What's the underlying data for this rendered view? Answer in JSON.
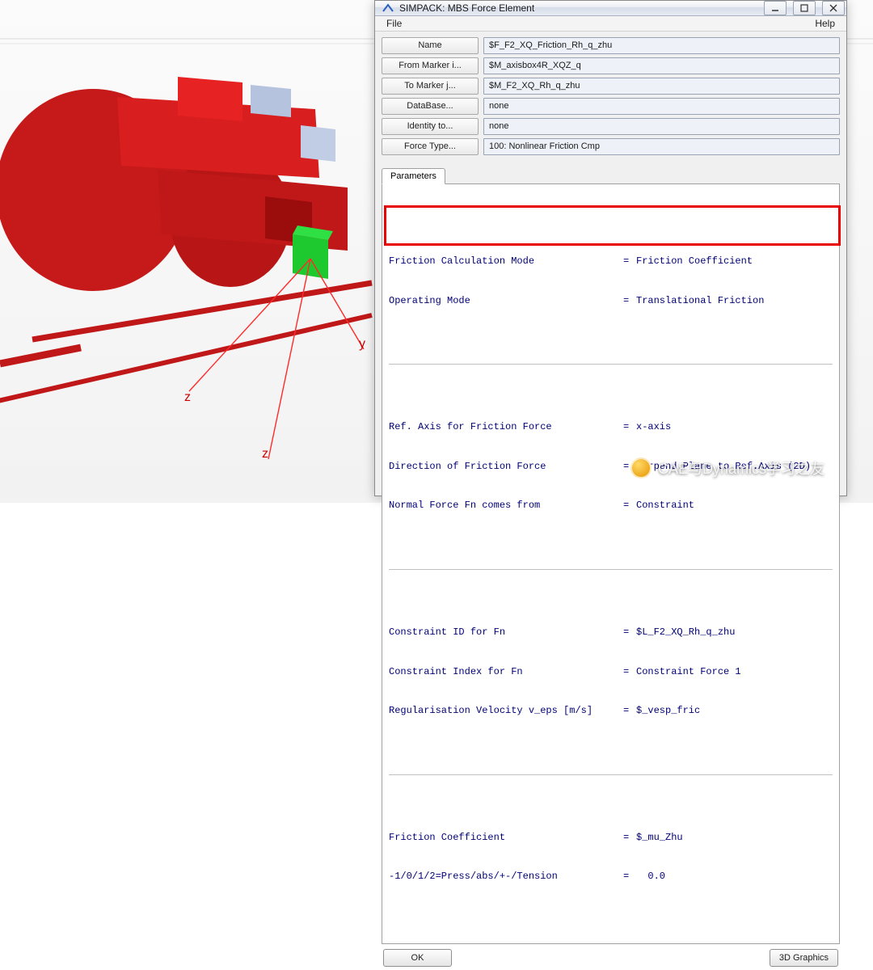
{
  "watermark": "CAE与Dynamics学习之友",
  "axes": {
    "y": "y",
    "z1": "z",
    "z2": "z"
  },
  "dialog": {
    "title": "SIMPACK: MBS Force Element",
    "menu": {
      "file": "File",
      "help": "Help"
    },
    "fields": {
      "name": {
        "label": "Name",
        "value": "$F_F2_XQ_Friction_Rh_q_zhu"
      },
      "from_marker": {
        "label": "From Marker i...",
        "value": "$M_axisbox4R_XQZ_q"
      },
      "to_marker": {
        "label": "To Marker j...",
        "value": "$M_F2_XQ_Rh_q_zhu"
      },
      "database": {
        "label": "DataBase...",
        "value": "none"
      },
      "identity_to": {
        "label": "Identity to...",
        "value": "none"
      },
      "force_type": {
        "label": "Force Type...",
        "value": "100: Nonlinear Friction   Cmp"
      }
    },
    "tab": "Parameters",
    "params": {
      "g1": [
        {
          "k": "Friction Calculation Mode",
          "v": "Friction Coefficient"
        },
        {
          "k": "Operating Mode",
          "v": "Translational Friction"
        }
      ],
      "g2": [
        {
          "k": "Ref. Axis for Friction Force",
          "v": "x-axis"
        },
        {
          "k": "Direction of Friction Force",
          "v": "Perpend.Plane to Ref.Axis (2D)"
        },
        {
          "k": "Normal Force Fn comes from",
          "v": "Constraint"
        }
      ],
      "g3": [
        {
          "k": "Constraint ID for Fn",
          "v": "$L_F2_XQ_Rh_q_zhu"
        },
        {
          "k": "Constraint Index for Fn",
          "v": "Constraint Force 1"
        },
        {
          "k": "Regularisation Velocity v_eps [m/s]",
          "v": "$_vesp_fric"
        }
      ],
      "g4": [
        {
          "k": "Friction Coefficient",
          "v": "$_mu_Zhu"
        },
        {
          "k": "-1/0/1/2=Press/abs/+-/Tension",
          "v": "  0.0"
        }
      ]
    },
    "buttons": {
      "ok": "OK",
      "graphics": "3D Graphics"
    }
  }
}
